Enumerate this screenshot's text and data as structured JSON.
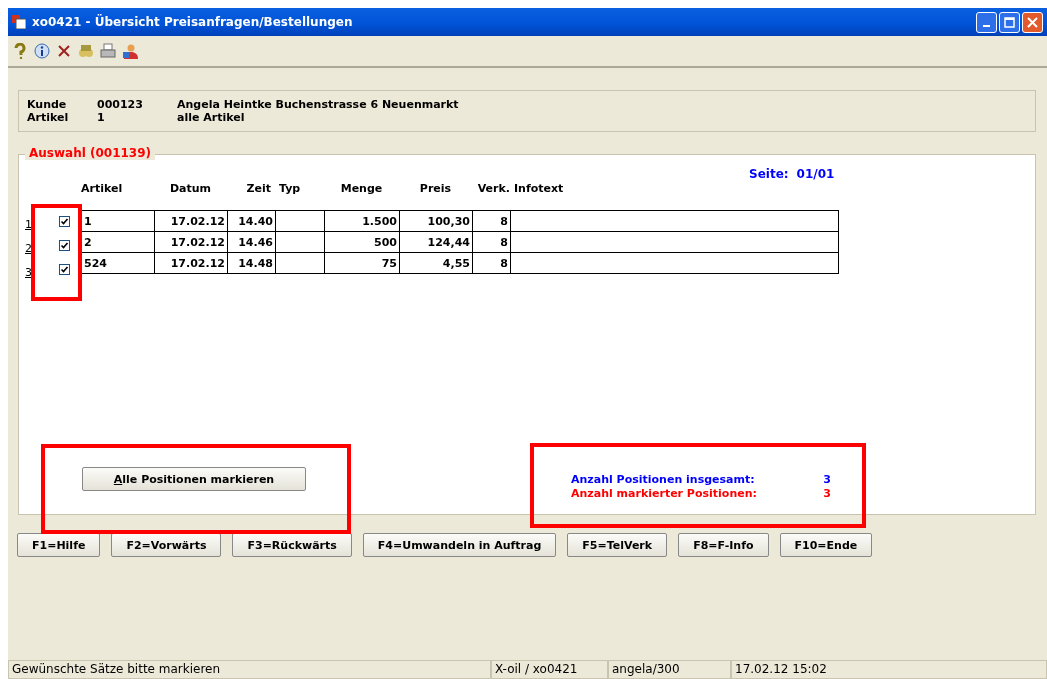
{
  "window": {
    "title": "xo0421 - Übersicht Preisanfragen/Bestellungen"
  },
  "header": [
    {
      "label": "Kunde",
      "value": "000123",
      "description": "Angela Heintke Buchenstrasse 6 Neuenmarkt"
    },
    {
      "label": "Artikel",
      "value": "1",
      "description": "alle Artikel"
    }
  ],
  "selection": {
    "legend": "Auswahl (001139)",
    "page_label": "Seite:",
    "page_value": "01/01",
    "columns": [
      "Artikel",
      "Datum",
      "Zeit",
      "Typ",
      "Menge",
      "Preis",
      "Verk.",
      "Infotext"
    ],
    "rows": [
      {
        "number": "1",
        "checked": true,
        "cells": [
          "1",
          "17.02.12",
          "14.40",
          "",
          "1.500",
          "100,30",
          "8",
          ""
        ]
      },
      {
        "number": "2",
        "checked": true,
        "cells": [
          "2",
          "17.02.12",
          "14.46",
          "",
          "500",
          "124,44",
          "8",
          ""
        ]
      },
      {
        "number": "3",
        "checked": true,
        "cells": [
          "524",
          "17.02.12",
          "14.48",
          "",
          "75",
          "4,55",
          "8",
          ""
        ]
      }
    ],
    "mark_all_button": "Alle Positionen markieren",
    "summary": [
      {
        "label": "Anzahl Positionen insgesamt:",
        "value": "3",
        "color": "#0000ff"
      },
      {
        "label": "Anzahl markierter Positionen:",
        "value": "3",
        "color": "#ff0000"
      }
    ]
  },
  "function_keys": [
    "F1=Hilfe",
    "F2=Vorwärts",
    "F3=Rückwärts",
    "F4=Umwandeln in Auftrag",
    "F5=TelVerk",
    "F8=F-Info",
    "F10=Ende"
  ],
  "status_bar": [
    "Gewünschte Sätze bitte markieren",
    "X-oil / xo0421",
    "angela/300",
    "17.02.12 15:02"
  ]
}
